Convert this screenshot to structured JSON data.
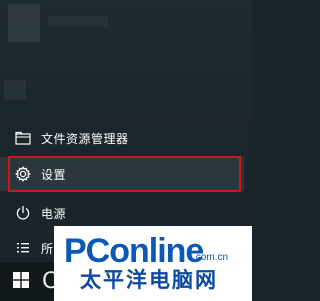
{
  "start_menu": {
    "items": [
      {
        "label": "文件资源管理器",
        "icon": "folder-icon"
      },
      {
        "label": "设置",
        "icon": "gear-icon",
        "highlighted": true
      },
      {
        "label": "电源",
        "icon": "power-icon"
      },
      {
        "label": "所",
        "icon": "list-icon"
      }
    ]
  },
  "taskbar": {
    "start_icon": "windows-logo-icon",
    "search_glyph": "C"
  },
  "watermark": {
    "brand_pc": "PC",
    "brand_online": "online",
    "domain": ".com.cn",
    "chinese": "太平洋电脑网"
  },
  "colors": {
    "highlight_border": "#d0141c",
    "watermark_blue": "#0b58b6"
  }
}
